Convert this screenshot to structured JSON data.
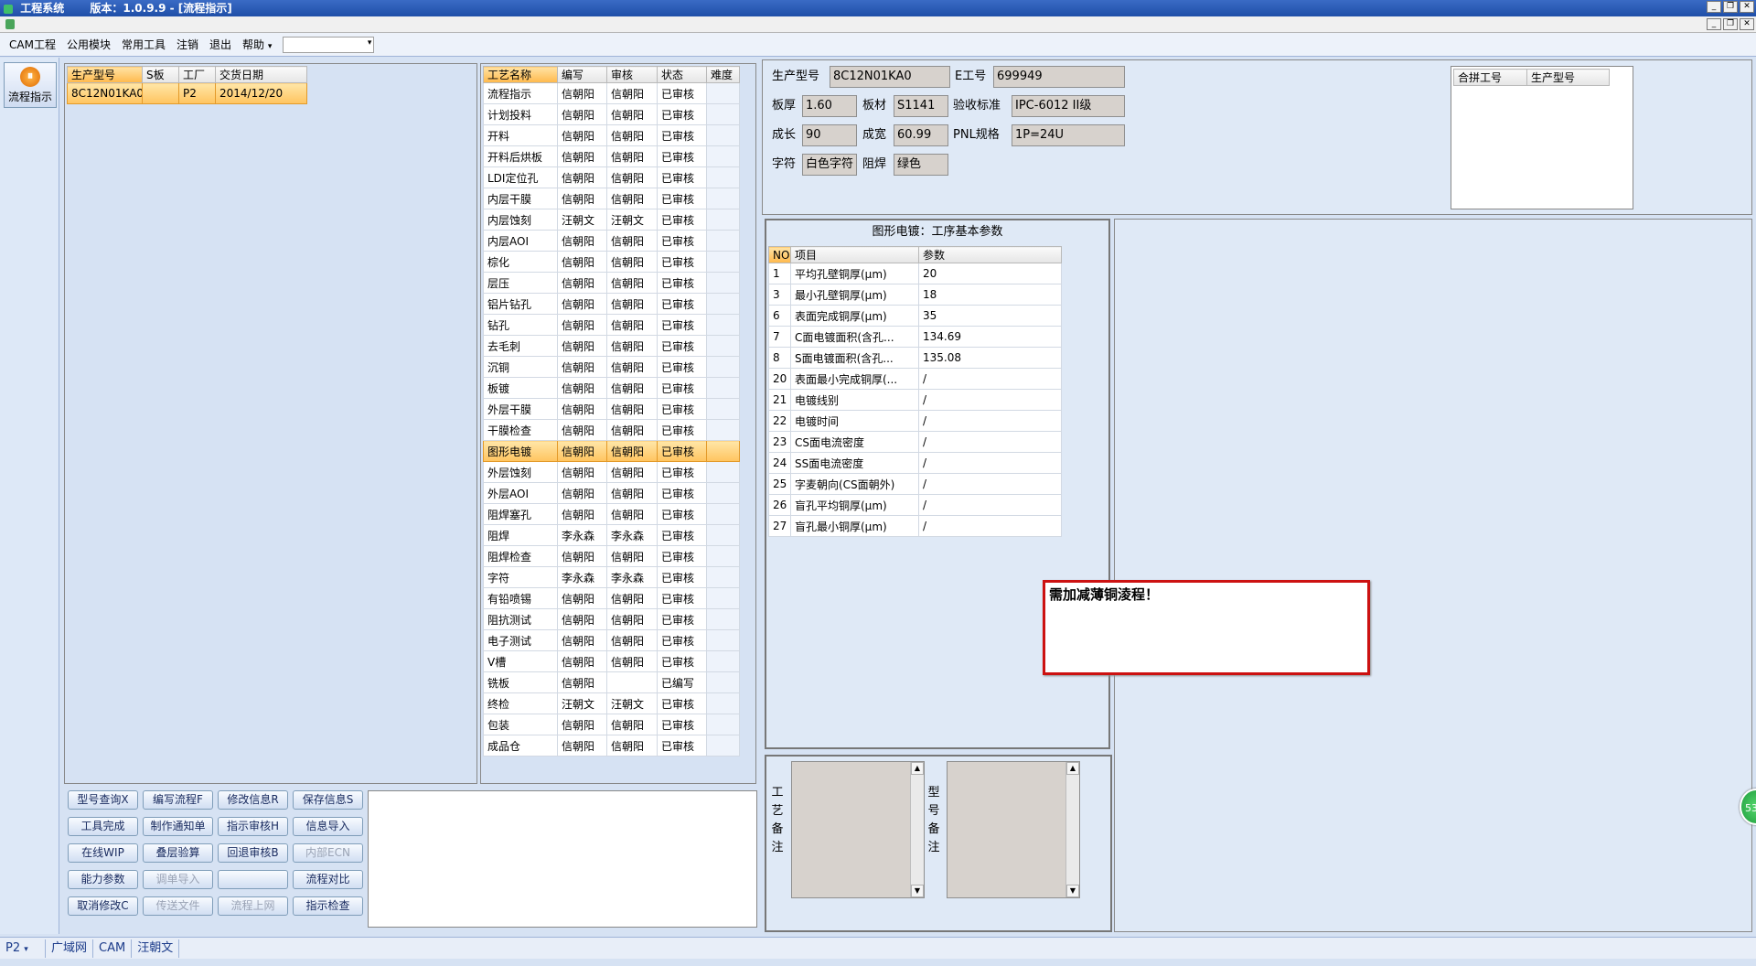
{
  "window": {
    "title": "工程系统",
    "version": "版本：1.0.9.9 - [流程指示]",
    "min": "_",
    "restore": "❐",
    "close": "✕"
  },
  "menu": [
    "CAM工程",
    "公用模块",
    "常用工具",
    "注销",
    "退出",
    "帮助"
  ],
  "help_arrow": "▾",
  "sidebar": {
    "flow_button": "流程指示",
    "flow_icon_glyph": "⏸"
  },
  "product_table": {
    "headers": [
      "生产型号",
      "S板",
      "工厂",
      "交货日期"
    ],
    "rows": [
      [
        "8C12N01KA0",
        "",
        "P2",
        "2014/12/20"
      ]
    ]
  },
  "process_table": {
    "headers": [
      "工艺名称",
      "编写",
      "审核",
      "状态",
      "难度"
    ],
    "rows": [
      [
        "流程指示",
        "信朝阳",
        "信朝阳",
        "已审核",
        ""
      ],
      [
        "计划投料",
        "信朝阳",
        "信朝阳",
        "已审核",
        ""
      ],
      [
        "开料",
        "信朝阳",
        "信朝阳",
        "已审核",
        ""
      ],
      [
        "开料后烘板",
        "信朝阳",
        "信朝阳",
        "已审核",
        ""
      ],
      [
        "LDI定位孔",
        "信朝阳",
        "信朝阳",
        "已审核",
        ""
      ],
      [
        "内层干膜",
        "信朝阳",
        "信朝阳",
        "已审核",
        ""
      ],
      [
        "内层蚀刻",
        "汪朝文",
        "汪朝文",
        "已审核",
        ""
      ],
      [
        "内层AOI",
        "信朝阳",
        "信朝阳",
        "已审核",
        ""
      ],
      [
        "棕化",
        "信朝阳",
        "信朝阳",
        "已审核",
        ""
      ],
      [
        "层压",
        "信朝阳",
        "信朝阳",
        "已审核",
        ""
      ],
      [
        "铝片钻孔",
        "信朝阳",
        "信朝阳",
        "已审核",
        ""
      ],
      [
        "钻孔",
        "信朝阳",
        "信朝阳",
        "已审核",
        ""
      ],
      [
        "去毛刺",
        "信朝阳",
        "信朝阳",
        "已审核",
        ""
      ],
      [
        "沉铜",
        "信朝阳",
        "信朝阳",
        "已审核",
        ""
      ],
      [
        "板镀",
        "信朝阳",
        "信朝阳",
        "已审核",
        ""
      ],
      [
        "外层干膜",
        "信朝阳",
        "信朝阳",
        "已审核",
        ""
      ],
      [
        "干膜检查",
        "信朝阳",
        "信朝阳",
        "已审核",
        ""
      ],
      [
        "图形电镀",
        "信朝阳",
        "信朝阳",
        "已审核",
        ""
      ],
      [
        "外层蚀刻",
        "信朝阳",
        "信朝阳",
        "已审核",
        ""
      ],
      [
        "外层AOI",
        "信朝阳",
        "信朝阳",
        "已审核",
        ""
      ],
      [
        "阻焊塞孔",
        "信朝阳",
        "信朝阳",
        "已审核",
        ""
      ],
      [
        "阻焊",
        "李永森",
        "李永森",
        "已审核",
        ""
      ],
      [
        "阻焊检查",
        "信朝阳",
        "信朝阳",
        "已审核",
        ""
      ],
      [
        "字符",
        "李永森",
        "李永森",
        "已审核",
        ""
      ],
      [
        "有铅喷锡",
        "信朝阳",
        "信朝阳",
        "已审核",
        ""
      ],
      [
        "阻抗测试",
        "信朝阳",
        "信朝阳",
        "已审核",
        ""
      ],
      [
        "电子测试",
        "信朝阳",
        "信朝阳",
        "已审核",
        ""
      ],
      [
        "V槽",
        "信朝阳",
        "信朝阳",
        "已审核",
        ""
      ],
      [
        "铣板",
        "信朝阳",
        "",
        "已编写",
        ""
      ],
      [
        "终检",
        "汪朝文",
        "汪朝文",
        "已审核",
        ""
      ],
      [
        "包装",
        "信朝阳",
        "信朝阳",
        "已审核",
        ""
      ],
      [
        "成品仓",
        "信朝阳",
        "信朝阳",
        "已审核",
        ""
      ]
    ],
    "selected_index": 17
  },
  "buttons": [
    [
      "型号查询X",
      "编写流程F",
      "修改信息R",
      "保存信息S"
    ],
    [
      "工具完成",
      "制作通知单",
      "指示审核H",
      "信息导入"
    ],
    [
      "在线WIP",
      "叠层验算",
      "回退审核B",
      "内部ECN"
    ],
    [
      "能力参数",
      "调单导入",
      "",
      "流程对比"
    ],
    [
      "取消修改C",
      "传送文件",
      "流程上网",
      "指示检查"
    ]
  ],
  "disabled_buttons": [
    "内部ECN",
    "调单导入",
    "传送文件",
    "流程上网",
    ""
  ],
  "info": {
    "prod_label": "生产型号",
    "prod_value": "8C12N01KA0",
    "e_label": "E工号",
    "e_value": "699949",
    "thick_label": "板厚",
    "thick_value": "1.60",
    "mat_label": "板材",
    "mat_value": "S1141",
    "std_label": "验收标准",
    "std_value": "IPC-6012 II级",
    "len_label": "成长",
    "len_value": "90",
    "wid_label": "成宽",
    "wid_value": "60.99",
    "pnl_label": "PNL规格",
    "pnl_value": "1P=24U",
    "char_label": "字符",
    "char_value": "白色字符",
    "mask_label": "阻焊",
    "mask_value": "绿色"
  },
  "merge_table": {
    "headers": [
      "合拼工号",
      "生产型号"
    ]
  },
  "params": {
    "title": "图形电镀：工序基本参数",
    "headers": [
      "NO",
      "项目",
      "参数"
    ],
    "rows": [
      [
        "1",
        "平均孔壁铜厚(μm)",
        "20"
      ],
      [
        "3",
        "最小孔壁铜厚(μm)",
        "18"
      ],
      [
        "6",
        "表面完成铜厚(μm)",
        "35"
      ],
      [
        "7",
        "C面电镀面积(含孔...",
        "134.69"
      ],
      [
        "8",
        "S面电镀面积(含孔...",
        "135.08"
      ],
      [
        "20",
        "表面最小完成铜厚(...",
        "/"
      ],
      [
        "21",
        "电镀线别",
        "/"
      ],
      [
        "22",
        "电镀时间",
        "/"
      ],
      [
        "23",
        "CS面电流密度",
        "/"
      ],
      [
        "24",
        "SS面电流密度",
        "/"
      ],
      [
        "25",
        "字麦朝向(CS面朝外)",
        "/"
      ],
      [
        "26",
        "盲孔平均铜厚(μm)",
        "/"
      ],
      [
        "27",
        "盲孔最小铜厚(μm)",
        "/"
      ]
    ]
  },
  "notes": {
    "craft_label": [
      "工",
      "艺",
      "备",
      "注"
    ],
    "model_label": [
      "型",
      "号",
      "备",
      "注"
    ]
  },
  "alert": {
    "text": "需加减薄铜淩程！",
    "color": "#cc1111"
  },
  "badge": {
    "text": "53"
  },
  "status": {
    "plant": "P2",
    "plant_arrow": "▾",
    "network": "广域网",
    "module": "CAM",
    "user": "汪朝文"
  }
}
